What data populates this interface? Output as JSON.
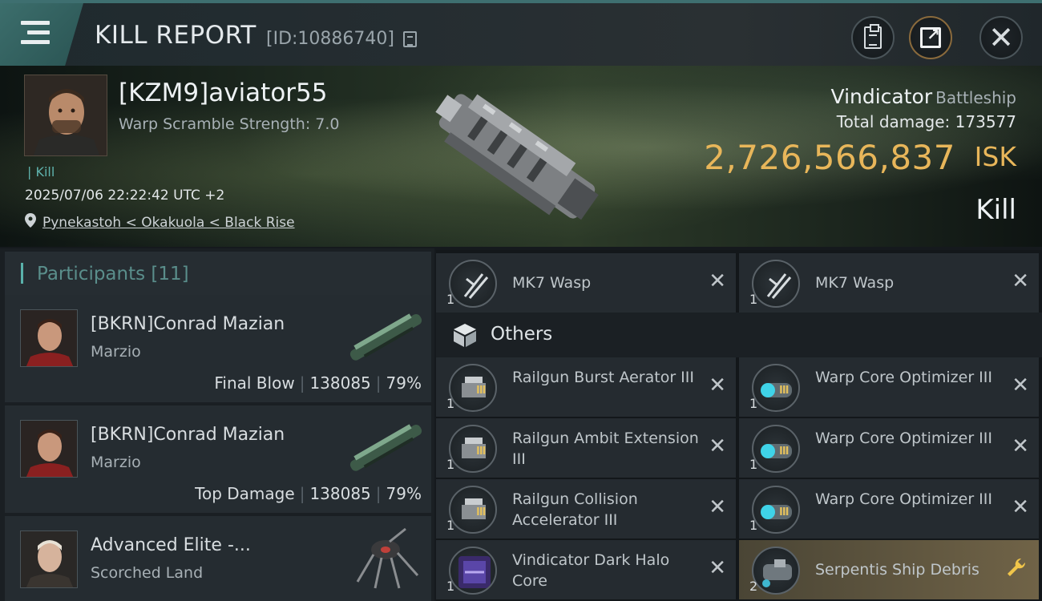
{
  "header": {
    "title": "KILL REPORT",
    "report_id": "[ID:10886740]"
  },
  "victim": {
    "name": "[KZM9]aviator55",
    "warp_scramble": "Warp Scramble Strength: 7.0",
    "tag": "Kill",
    "timestamp": "2025/07/06 22:22:42 UTC +2",
    "location": "Pynekastoh < Okakuola < Black Rise",
    "ship_name": "Vindicator",
    "ship_class": "Battleship",
    "total_damage_label": "Total damage:",
    "total_damage_value": "173577",
    "isk_value": "2,726,566,837",
    "isk_unit": "ISK",
    "result": "Kill"
  },
  "participants": {
    "title": "Participants [11]",
    "rows": [
      {
        "name": "[BKRN]Conrad Mazian",
        "ship": "Marzio",
        "role": "Final Blow",
        "damage": "138085",
        "percent": "79%"
      },
      {
        "name": "[BKRN]Conrad Mazian",
        "ship": "Marzio",
        "role": "Top Damage",
        "damage": "138085",
        "percent": "79%"
      },
      {
        "name": "Advanced Elite -...",
        "ship": "Scorched Land",
        "role": "",
        "damage": "",
        "percent": ""
      }
    ]
  },
  "items": {
    "drones": [
      {
        "name": "MK7  Wasp",
        "qty": "1"
      },
      {
        "name": "MK7  Wasp",
        "qty": "1"
      }
    ],
    "others_title": "Others",
    "others": [
      {
        "name": "Railgun Burst Aerator III",
        "qty": "1",
        "tier": "III"
      },
      {
        "name": "Warp Core Optimizer III",
        "qty": "1",
        "tier": "III"
      },
      {
        "name": "Railgun Ambit Extension III",
        "qty": "1",
        "tier": "III"
      },
      {
        "name": "Warp Core Optimizer III",
        "qty": "1",
        "tier": "III"
      },
      {
        "name": "Railgun Collision Accelerator III",
        "qty": "1",
        "tier": "III"
      },
      {
        "name": "Warp Core Optimizer III",
        "qty": "1",
        "tier": "III"
      },
      {
        "name": "Vindicator Dark Halo Core",
        "qty": "1",
        "tier": ""
      },
      {
        "name": "Serpentis Ship Debris",
        "qty": "2",
        "tier": ""
      }
    ]
  },
  "colors": {
    "accent_teal": "#5ab1ab",
    "isk_gold": "#e8b65a",
    "highlight_row": "#706347"
  }
}
